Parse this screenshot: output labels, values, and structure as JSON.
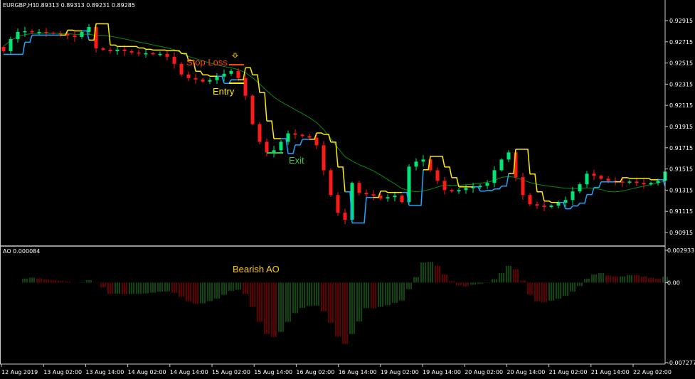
{
  "header": {
    "symbol": "EURGBP,H1",
    "ohlc": "0.89313 0.89313 0.89231 0.89285"
  },
  "indicator_label": "AO 0.000084",
  "colors": {
    "bull": "#00e676",
    "bear": "#ff1a1a",
    "trail_up": "#1ea7ff",
    "trail_down": "#ffee00",
    "ma": "#0a8a0a",
    "stop_loss": "#ff4500",
    "entry": "#ffee00",
    "exit": "#2ecc40",
    "ao_up": "#1b8f1b",
    "ao_down": "#c00000",
    "axis": "#c8c8c8"
  },
  "chart_data": [
    {
      "type": "candlestick",
      "title": "EURGBP,H1",
      "ylim": [
        0.90815,
        0.93015
      ],
      "y_ticks": [
        "0.92915",
        "0.92715",
        "0.92515",
        "0.92315",
        "0.92115",
        "0.91915",
        "0.91715",
        "0.91515",
        "0.91315",
        "0.91115",
        "0.90915"
      ],
      "x_ticks": [
        "12 Aug 2019",
        "13 Aug 02:00",
        "13 Aug 14:00",
        "14 Aug 02:00",
        "14 Aug 14:00",
        "15 Aug 02:00",
        "15 Aug 14:00",
        "16 Aug 02:00",
        "16 Aug 14:00",
        "19 Aug 02:00",
        "19 Aug 14:00",
        "20 Aug 02:00",
        "20 Aug 14:00",
        "21 Aug 02:00",
        "21 Aug 14:00",
        "22 Aug 02:00"
      ],
      "closes": [
        0.92627,
        0.92741,
        0.92808,
        0.92815,
        0.92808,
        0.92808,
        0.92801,
        0.92795,
        0.92788,
        0.92775,
        0.92761,
        0.92808,
        0.92855,
        0.92654,
        0.92641,
        0.92627,
        0.92641,
        0.92627,
        0.92614,
        0.92607,
        0.92607,
        0.92601,
        0.92601,
        0.92574,
        0.92507,
        0.92407,
        0.92373,
        0.9236,
        0.9234,
        0.92353,
        0.92387,
        0.92413,
        0.9244,
        0.92373,
        0.92206,
        0.91938,
        0.91771,
        0.91671,
        0.91691,
        0.91771,
        0.91851,
        0.91838,
        0.91825,
        0.91811,
        0.91738,
        0.91503,
        0.91269,
        0.91102,
        0.91035,
        0.91383,
        0.91289,
        0.91276,
        0.91263,
        0.91236,
        0.91249,
        0.91263,
        0.91202,
        0.91537,
        0.91584,
        0.91604,
        0.91503,
        0.91403,
        0.91316,
        0.91303,
        0.91316,
        0.91336,
        0.91343,
        0.91356,
        0.91383,
        0.91503,
        0.91604,
        0.91671,
        0.91437,
        0.91269,
        0.91182,
        0.91169,
        0.91156,
        0.91169,
        0.91196,
        0.91222,
        0.91303,
        0.9137,
        0.9147,
        0.9145,
        0.91423,
        0.91403,
        0.91396,
        0.9139,
        0.91396,
        0.91383,
        0.9137,
        0.91383,
        0.91403,
        0.9149
      ],
      "annotations": {
        "stop_loss": "Stop Loss",
        "entry": "Entry",
        "exit": "Exit"
      }
    },
    {
      "type": "bar",
      "title": "AO",
      "ylim": [
        -0.007277,
        0.002933
      ],
      "y_ticks": [
        "0.002933",
        "0.00",
        "-0.007277"
      ],
      "annotation": "Bearish AO"
    }
  ]
}
